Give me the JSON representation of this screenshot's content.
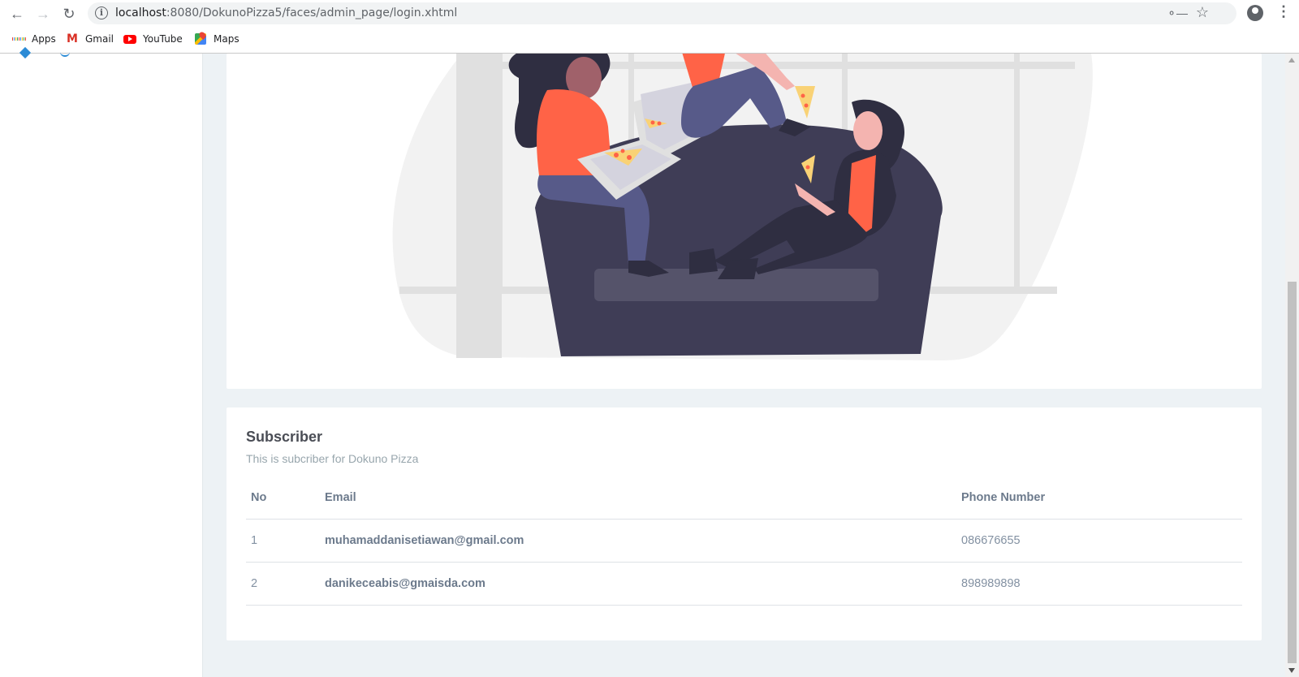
{
  "browser": {
    "url_host": "localhost",
    "url_rest": ":8080/DokunoPizza5/faces/admin_page/login.xhtml",
    "bookmarks": [
      {
        "label": "Apps",
        "icon": "apps-grid-icon"
      },
      {
        "label": "Gmail",
        "icon": "gmail-icon"
      },
      {
        "label": "YouTube",
        "icon": "youtube-icon"
      },
      {
        "label": "Maps",
        "icon": "maps-icon"
      }
    ]
  },
  "subscriber_card": {
    "title": "Subscriber",
    "subtitle": "This is subcriber for Dokuno Pizza",
    "columns": [
      "No",
      "Email",
      "Phone Number"
    ],
    "rows": [
      {
        "no": "1",
        "email": "muhamaddanisetiawan@gmail.com",
        "phone": "086676655"
      },
      {
        "no": "2",
        "email": "danikeceabis@gmaisda.com",
        "phone": "898989898"
      }
    ]
  },
  "colors": {
    "page_bg": "#edf2f5",
    "accent_orange": "#ff6347",
    "sofa": "#3f3d56",
    "link_blue": "#2b8bd6"
  }
}
